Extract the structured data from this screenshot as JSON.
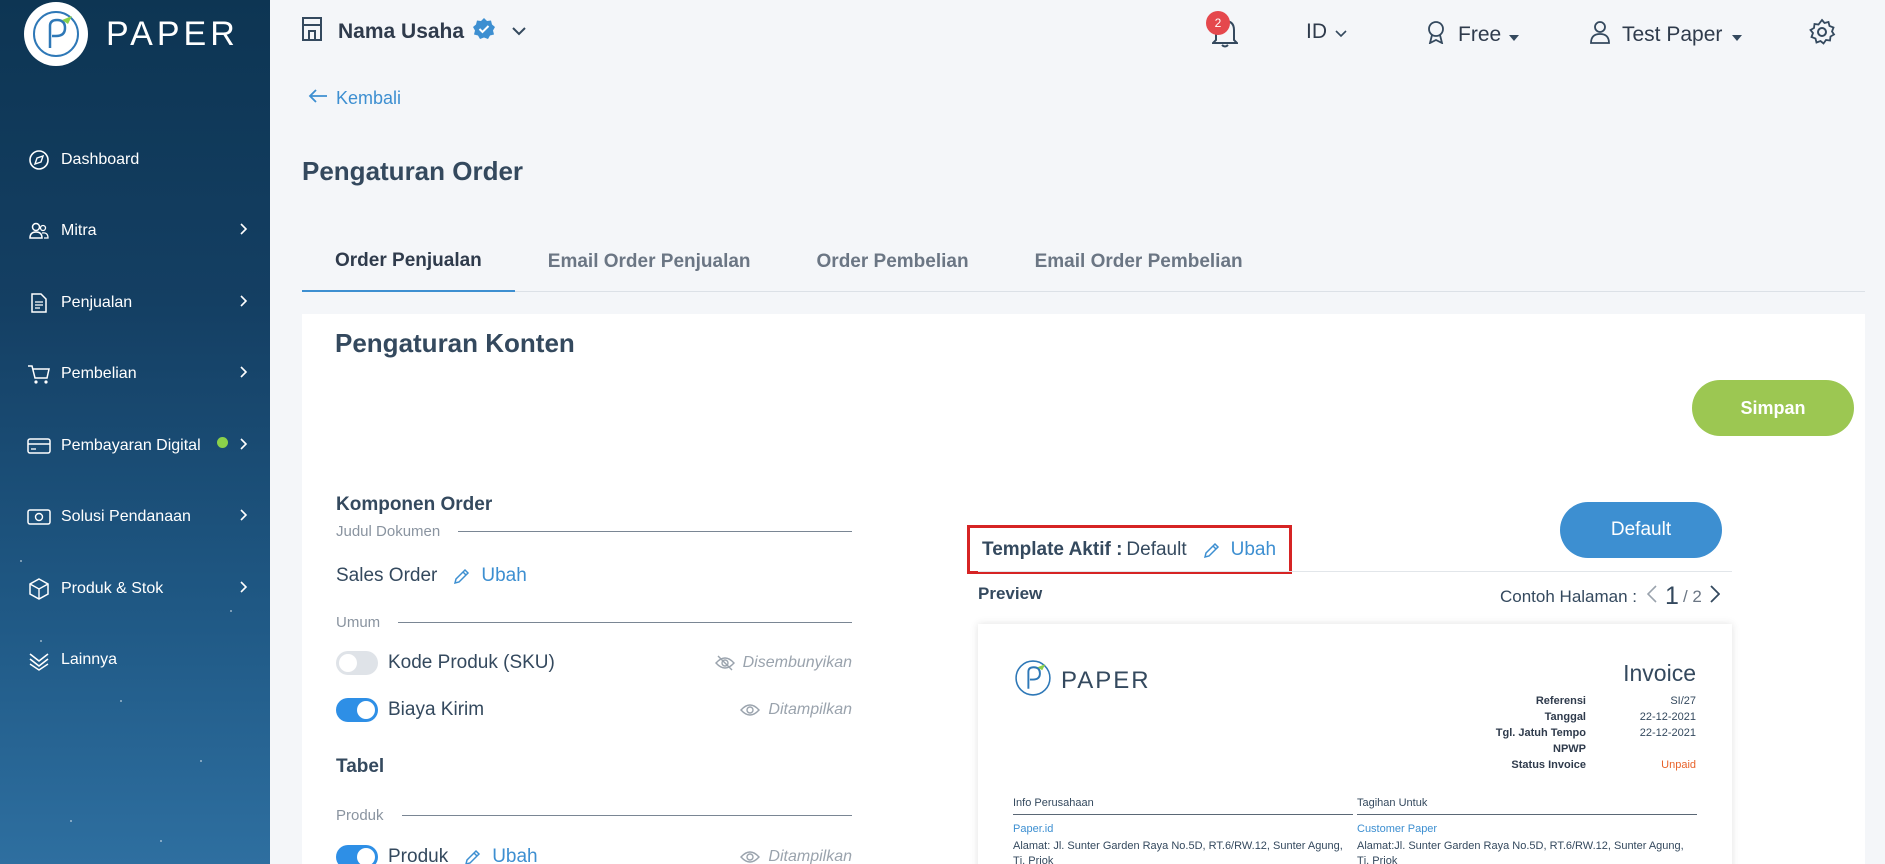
{
  "brand": {
    "name": "PAPER"
  },
  "sidebar": {
    "items": [
      {
        "label": "Dashboard",
        "icon": "compass-icon",
        "has_chevron": false
      },
      {
        "label": "Mitra",
        "icon": "users-icon",
        "has_chevron": true
      },
      {
        "label": "Penjualan",
        "icon": "document-icon",
        "has_chevron": true
      },
      {
        "label": "Pembelian",
        "icon": "cart-icon",
        "has_chevron": true
      },
      {
        "label": "Pembayaran Digital",
        "icon": "card-icon",
        "has_chevron": true,
        "dot_color": "#8bd14a"
      },
      {
        "label": "Solusi Pendanaan",
        "icon": "funding-icon",
        "has_chevron": true
      },
      {
        "label": "Produk & Stok",
        "icon": "box-icon",
        "has_chevron": true
      },
      {
        "label": "Lainnya",
        "icon": "layers-icon",
        "has_chevron": false
      }
    ]
  },
  "topbar": {
    "business_name": "Nama Usaha",
    "notification_count": "2",
    "language": "ID",
    "plan": "Free",
    "user_name": "Test Paper"
  },
  "main": {
    "back_label": "Kembali",
    "page_title": "Pengaturan Order",
    "tabs": [
      {
        "label": "Order Penjualan",
        "active": true
      },
      {
        "label": "Email Order Penjualan",
        "active": false
      },
      {
        "label": "Order Pembelian",
        "active": false
      },
      {
        "label": "Email Order Pembelian",
        "active": false
      }
    ]
  },
  "content": {
    "title": "Pengaturan Konten",
    "save_label": "Simpan",
    "komponen_order": "Komponen Order",
    "judul_dokumen": "Judul Dokumen",
    "document_title": "Sales Order",
    "ubah": "Ubah",
    "umum": "Umum",
    "fields": [
      {
        "label": "Kode Produk (SKU)",
        "on": false,
        "status": "Disembunyikan"
      },
      {
        "label": "Biaya Kirim",
        "on": true,
        "status": "Ditampilkan"
      }
    ],
    "tabel": "Tabel",
    "produk_section": "Produk",
    "produk_field": {
      "label": "Produk",
      "on": true,
      "status": "Ditampilkan"
    }
  },
  "template": {
    "label": "Template Aktif :",
    "value": "Default",
    "ubah": "Ubah",
    "default_button": "Default",
    "preview_label": "Preview",
    "contoh_label": "Contoh Halaman :",
    "page_current": "1",
    "page_total": "/ 2"
  },
  "invoice": {
    "brand": "PAPER",
    "title": "Invoice",
    "meta": [
      {
        "k": "Referensi",
        "v": "SI/27"
      },
      {
        "k": "Tanggal",
        "v": "22-12-2021"
      },
      {
        "k": "Tgl. Jatuh Tempo",
        "v": "22-12-2021"
      },
      {
        "k": "NPWP",
        "v": ""
      },
      {
        "k": "Status Invoice",
        "v": "Unpaid"
      }
    ],
    "info_perusahaan": "Info Perusahaan",
    "company_name": "Paper.id",
    "company_address": "Alamat: Jl. Sunter Garden Raya No.5D, RT.6/RW.12, Sunter Agung, Tj. Priok",
    "tagihan_untuk": "Tagihan Untuk",
    "customer_name": "Customer Paper",
    "customer_address": "Alamat:Jl. Sunter Garden Raya No.5D, RT.6/RW.12, Sunter Agung, Tj. Priok"
  },
  "colors": {
    "accent": "#3d8fd1",
    "save": "#9cc752",
    "unpaid": "#e8632b",
    "highlight": "#d62424"
  }
}
